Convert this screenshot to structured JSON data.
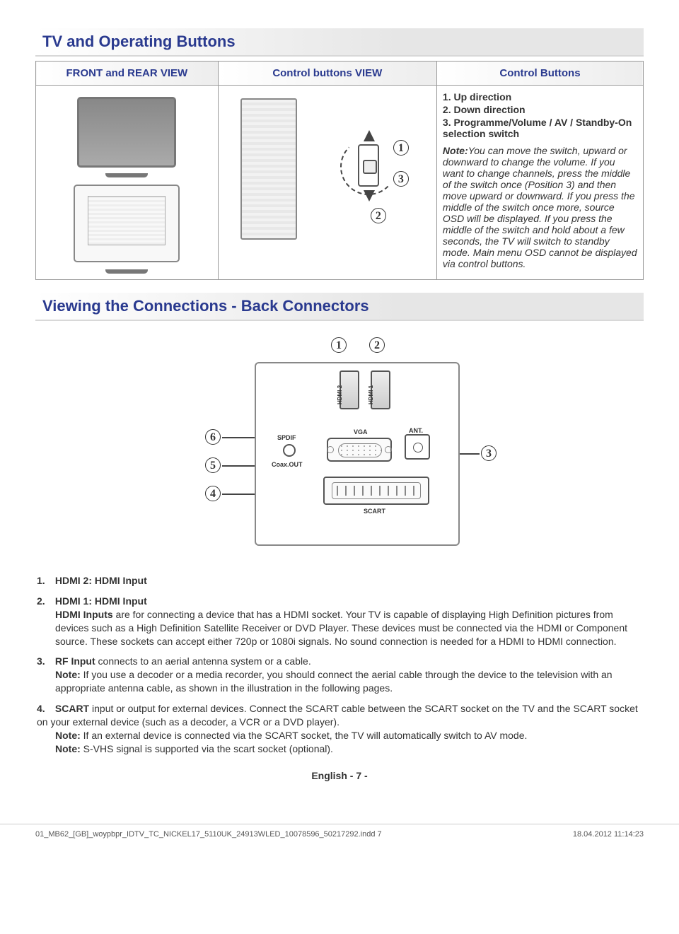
{
  "section1": {
    "title": "TV and Operating Buttons",
    "headers": [
      "FRONT and REAR VIEW",
      "Control buttons VIEW",
      "Control Buttons"
    ],
    "switch_markers": [
      "1",
      "2",
      "3"
    ],
    "list": [
      {
        "n": "1.",
        "t": "Up direction"
      },
      {
        "n": "2.",
        "t": "Down direction"
      },
      {
        "n": "3.",
        "t": "Programme/Volume / AV / Standby-On selection switch"
      }
    ],
    "note_label": "Note:",
    "note_body": "You can move the switch, upward or downward to change the volume. If you want to change channels, press the middle of the switch once (Position 3) and then move upward or downward. If you press the middle of the switch once more, source OSD will be displayed. If you press the middle of the switch and hold about a few seconds, the TV will switch to standby mode. Main menu OSD cannot be displayed via control buttons."
  },
  "section2": {
    "title": "Viewing the Connections - Back Connectors",
    "markers": [
      "1",
      "2",
      "3",
      "4",
      "5",
      "6"
    ],
    "panel_labels": {
      "hdmi2": "HDMI 2",
      "hdmi1": "HDMI 1",
      "vga": "VGA",
      "ant": "ANT.",
      "scart": "SCART",
      "spdif": "SPDIF",
      "coax": "Coax.OUT"
    },
    "descs": [
      {
        "n": "1.",
        "label": "HDMI 2: HDMI Input",
        "body": ""
      },
      {
        "n": "2.",
        "label": "HDMI 1: HDMI Input",
        "body": "HDMI Inputs are for connecting a device that has a HDMI socket. Your TV is capable of displaying High Definition pictures from devices such as a High Definition Satellite Receiver or DVD Player. These devices must be connected via the HDMI or Component source. These sockets can accept either 720p or 1080i signals. No sound connection is needed for a HDMI to HDMI connection.",
        "body_prefix_bold": "HDMI Inputs"
      },
      {
        "n": "3.",
        "label": "RF Input",
        "label_tail": " connects to an aerial antenna system or a cable.",
        "note_label": "Note:",
        "note": " If you use a decoder or a media recorder, you should connect the aerial cable through the device to the television with an appropriate antenna cable, as shown in the illustration in the following pages."
      },
      {
        "n": "4.",
        "label": "SCART",
        "label_tail": "  input or output for external devices. Connect the SCART cable between the SCART socket on the TV and the SCART socket on your external device (such as a decoder, a VCR or a DVD player).",
        "note_label": "Note:",
        "note": " If an external device is connected via the SCART socket, the TV will automatically switch to AV mode.",
        "note2_label": "Note:",
        "note2": " S-VHS signal is supported via the scart socket (optional)."
      }
    ]
  },
  "footer": {
    "center": "English   - 7 -",
    "left": "01_MB62_[GB]_woypbpr_IDTV_TC_NICKEL17_5110UK_24913WLED_10078596_50217292.indd   7",
    "right": "18.04.2012   11:14:23"
  }
}
